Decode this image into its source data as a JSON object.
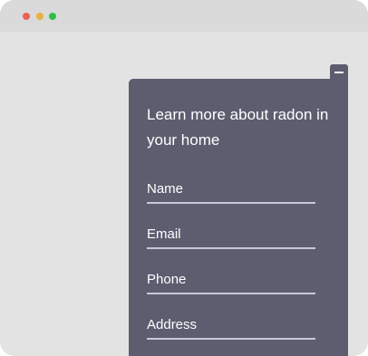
{
  "colors": {
    "window_background": "#e3e3e3",
    "titlebar_background": "#dadada",
    "close_dot": "#ec5f57",
    "minimize_dot": "#e8b040",
    "zoom_dot": "#2fc147",
    "panel_background": "#5c5d6f",
    "panel_text": "#ffffff",
    "field_underline": "#c7c9d6"
  },
  "window": {
    "controls": [
      "close-dot",
      "minimize-dot",
      "zoom-dot"
    ]
  },
  "widget": {
    "minimize_icon": "minus-icon",
    "title": "Learn more about radon in your home",
    "fields": [
      {
        "label": "Name"
      },
      {
        "label": "Email"
      },
      {
        "label": "Phone"
      },
      {
        "label": "Address"
      }
    ]
  }
}
